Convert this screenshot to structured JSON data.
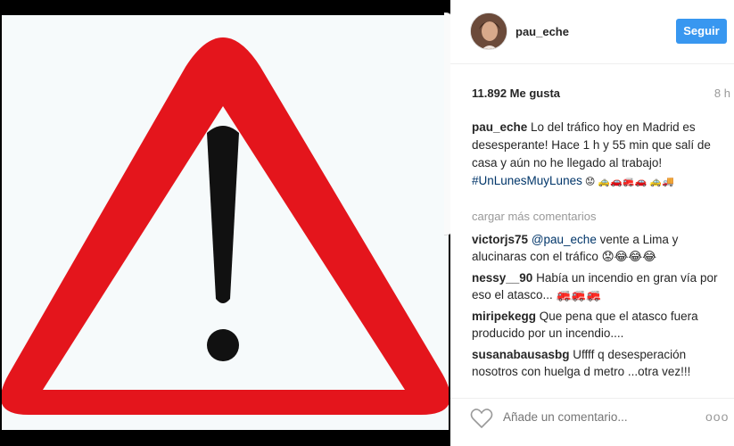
{
  "post": {
    "username": "pau_eche",
    "follow_label": "Seguir",
    "likes": "11.892 Me gusta",
    "time": "8 h",
    "caption": {
      "username": "pau_eche",
      "text": " Lo del tráfico hoy en Madrid es desesperante! Hace 1 h y 55 min que salí de casa y aún no he llegado al trabajo! ",
      "hashtag": "#UnLunesMuyLunes",
      "emoji": " 😟 🚕🚗🚒🚗 🚕🚚"
    },
    "load_more": "cargar más comentarios",
    "comments": [
      {
        "username": "victorjs75",
        "mention": "@pau_eche",
        "text": " vente a Lima y alucinaras con el tráfico 😟😂😂😂"
      },
      {
        "username": "nessy__90",
        "mention": "",
        "text": " Había un incendio en gran vía por eso el atasco... 🚒🚒🚒"
      },
      {
        "username": "miripekegg",
        "mention": "",
        "text": " Que pena que el atasco fuera producido por un incendio...."
      },
      {
        "username": "susanabausasbg",
        "mention": "",
        "text": " Uffff q desesperación nosotros con huelga d metro ...otra vez!!!"
      }
    ],
    "add_comment_placeholder": "Añade un comentario...",
    "more_label": "ooo"
  },
  "colors": {
    "follow_button": "#3897f0",
    "warning_red": "#e4151c",
    "hashtag": "#003569",
    "muted": "#999999"
  }
}
